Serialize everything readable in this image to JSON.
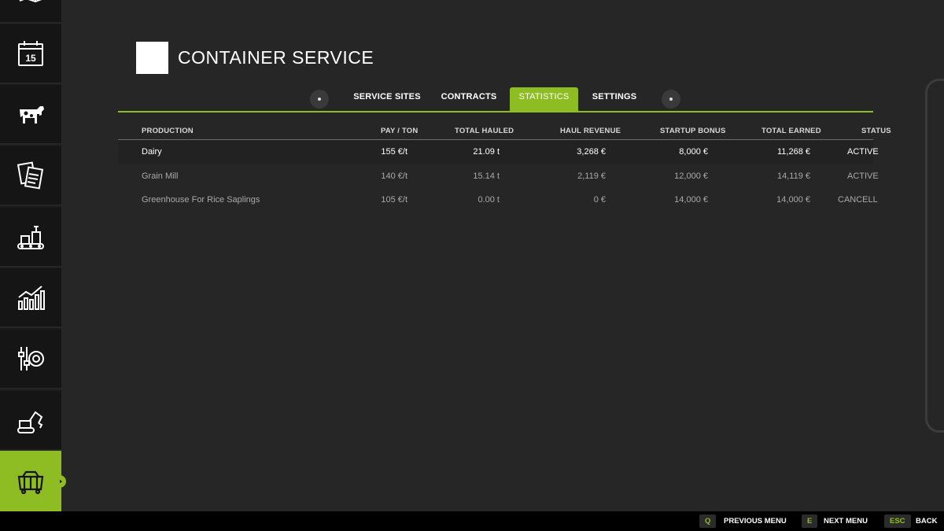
{
  "header": {
    "title": "CONTAINER SERVICE"
  },
  "sidebar": {
    "items": [
      {
        "icon": "map-icon"
      },
      {
        "icon": "calendar-icon",
        "day": "15"
      },
      {
        "icon": "cow-icon"
      },
      {
        "icon": "documents-icon"
      },
      {
        "icon": "production-icon"
      },
      {
        "icon": "statistics-icon"
      },
      {
        "icon": "settings-icon"
      },
      {
        "icon": "excavator-icon"
      },
      {
        "icon": "container-icon",
        "active": true
      }
    ]
  },
  "tabs": [
    {
      "label": "SERVICE SITES"
    },
    {
      "label": "CONTRACTS"
    },
    {
      "label": "STATISTICS",
      "active": true
    },
    {
      "label": "SETTINGS"
    }
  ],
  "table": {
    "columns": [
      "PRODUCTION",
      "PAY / TON",
      "TOTAL HAULED",
      "HAUL REVENUE",
      "STARTUP BONUS",
      "TOTAL EARNED",
      "STATUS"
    ],
    "rows": [
      {
        "production": "Dairy",
        "pay": "155 €/t",
        "hauled": "21.09 t",
        "revenue": "3,268 €",
        "bonus": "8,000 €",
        "earned": "11,268 €",
        "status": "ACTIVE"
      },
      {
        "production": "Grain Mill",
        "pay": "140 €/t",
        "hauled": "15.14 t",
        "revenue": "2,119 €",
        "bonus": "12,000 €",
        "earned": "14,119 €",
        "status": "ACTIVE"
      },
      {
        "production": "Greenhouse For Rice Saplings",
        "pay": "105 €/t",
        "hauled": "0.00 t",
        "revenue": "0 €",
        "bonus": "14,000 €",
        "earned": "14,000 €",
        "status": "CANCELLED"
      }
    ]
  },
  "footer": {
    "actions": [
      {
        "key": "Q",
        "label": "PREVIOUS MENU"
      },
      {
        "key": "E",
        "label": "NEXT MENU"
      },
      {
        "key": "ESC",
        "label": "BACK"
      }
    ]
  },
  "colors": {
    "accent": "#8ebd23",
    "background": "#262626",
    "sidebar": "#151515"
  }
}
